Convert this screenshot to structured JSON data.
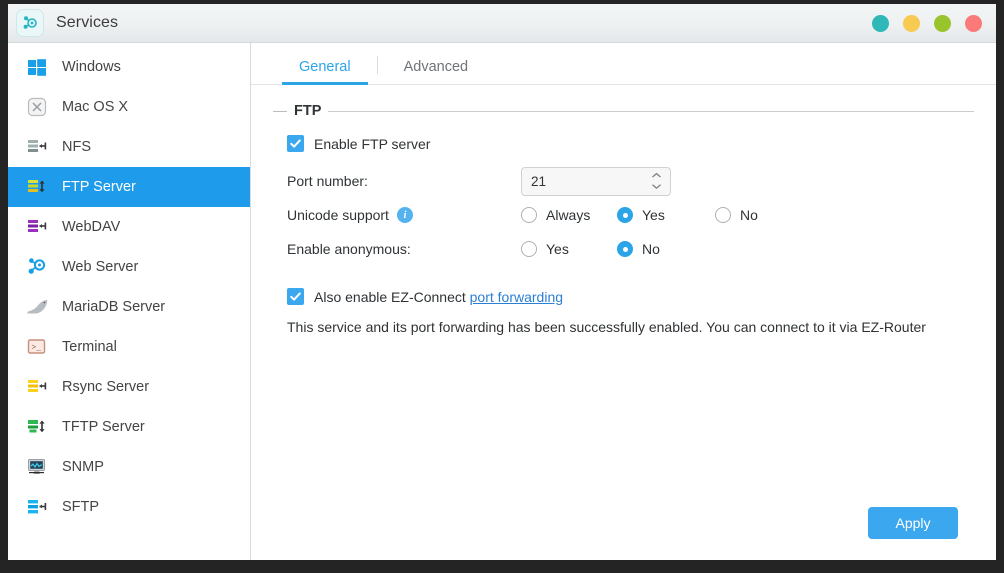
{
  "window": {
    "title": "Services",
    "icon": "services-node-icon",
    "controls": [
      {
        "name": "teal-dot",
        "color": "#2eb8b8"
      },
      {
        "name": "yellow-dot",
        "color": "#f7ca52"
      },
      {
        "name": "green-dot",
        "color": "#99c42c"
      },
      {
        "name": "red-dot",
        "color": "#fa7a7a"
      }
    ]
  },
  "sidebar": {
    "items": [
      {
        "label": "Windows",
        "icon": "windows-logo-icon",
        "selected": false
      },
      {
        "label": "Mac OS X",
        "icon": "mac-x-icon",
        "selected": false
      },
      {
        "label": "NFS",
        "icon": "nfs-server-icon",
        "selected": false
      },
      {
        "label": "FTP Server",
        "icon": "ftp-server-icon",
        "selected": true
      },
      {
        "label": "WebDAV",
        "icon": "webdav-server-icon",
        "selected": false
      },
      {
        "label": "Web Server",
        "icon": "web-server-icon",
        "selected": false
      },
      {
        "label": "MariaDB Server",
        "icon": "mariadb-seal-icon",
        "selected": false
      },
      {
        "label": "Terminal",
        "icon": "terminal-icon",
        "selected": false
      },
      {
        "label": "Rsync Server",
        "icon": "rsync-server-icon",
        "selected": false
      },
      {
        "label": "TFTP Server",
        "icon": "tftp-server-icon",
        "selected": false
      },
      {
        "label": "SNMP",
        "icon": "snmp-monitor-icon",
        "selected": false
      },
      {
        "label": "SFTP",
        "icon": "sftp-server-icon",
        "selected": false
      }
    ]
  },
  "tabs": [
    {
      "label": "General",
      "active": true
    },
    {
      "label": "Advanced",
      "active": false
    }
  ],
  "form": {
    "group_title": "FTP",
    "enable_server_label": "Enable FTP server",
    "enable_server_checked": true,
    "port_label": "Port number:",
    "port_value": "21",
    "unicode_label": "Unicode support",
    "unicode_info_icon": "info-icon",
    "unicode_options": [
      {
        "label": "Always",
        "selected": false
      },
      {
        "label": "Yes",
        "selected": true
      },
      {
        "label": "No",
        "selected": false
      }
    ],
    "anonymous_label": "Enable anonymous:",
    "anonymous_options": [
      {
        "label": "Yes",
        "selected": false
      },
      {
        "label": "No",
        "selected": true
      }
    ],
    "ezconnect_prefix": "Also enable EZ-Connect ",
    "ezconnect_link": "port forwarding",
    "ezconnect_checked": true,
    "status_note": "This service and its port forwarding has been successfully enabled. You can connect to it via EZ-Router"
  },
  "footer": {
    "apply_label": "Apply"
  },
  "colors": {
    "accent": "#2ba4e8",
    "selected_row": "#1e9ceb",
    "button": "#3ba7ef",
    "link": "#2b7fd4"
  }
}
